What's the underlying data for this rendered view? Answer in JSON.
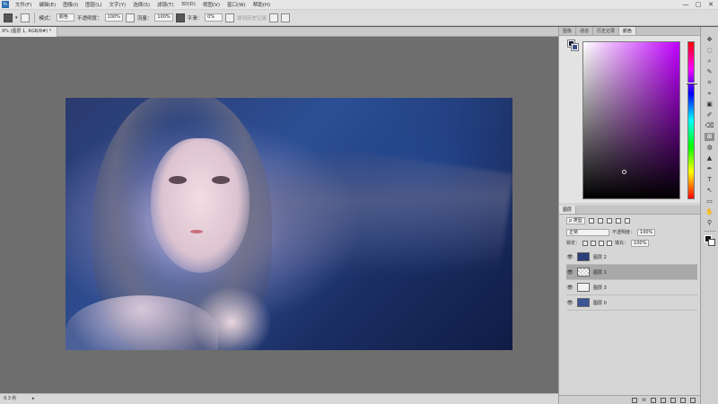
{
  "menubar": {
    "logo": "Ps",
    "items": [
      "文件(F)",
      "编辑(E)",
      "图像(I)",
      "图层(L)",
      "文字(Y)",
      "选择(S)",
      "滤镜(T)",
      "3D(D)",
      "视图(V)",
      "窗口(W)",
      "帮助(H)"
    ],
    "window_controls": [
      "—",
      "▢",
      "✕"
    ]
  },
  "options": {
    "mode_label": "模式：",
    "mode_value": "颜色",
    "opacity_label": "不透明度：",
    "opacity_value": "100%",
    "flow_label": "流量：",
    "flow_value": "100%",
    "smoothing_label": "平滑：",
    "smoothing_value": "0%",
    "history_label": "抹到历史记录"
  },
  "document": {
    "tab_title": "9% (图层 1, RGB/8#) *",
    "zoom_status": "9.3 秒"
  },
  "panels": {
    "top_tabs": [
      "图像",
      "通道",
      "历史记录",
      "颜色"
    ],
    "layers_tab": "图层",
    "kind_label": "ρ 类型",
    "blend_mode": "正常",
    "opacity_label": "不透明度：",
    "opacity_value": "100%",
    "lock_label": "锁定：",
    "fill_label": "填充：",
    "fill_value": "100%",
    "layers": [
      {
        "name": "图层 2",
        "visible_icon": "👁",
        "selected": false,
        "thumb": "#2c3f7a"
      },
      {
        "name": "图层 1",
        "visible_icon": "👁",
        "selected": true,
        "thumb": "#e7e7e7"
      },
      {
        "name": "图层 3",
        "visible_icon": "👁",
        "selected": false,
        "thumb": "#f2f2f2"
      },
      {
        "name": "图层 0",
        "visible_icon": "👁",
        "selected": false,
        "thumb": "#3a5498"
      }
    ],
    "footer_fx": "fx"
  },
  "tools": {
    "icons": [
      "✥",
      "◌",
      "⌕",
      "✎",
      "⌗",
      "⌖",
      "▣",
      "✐",
      "⌫",
      "⊞",
      "◍",
      "▲",
      "✒",
      "T",
      "↖",
      "▭",
      "✋",
      "⚲"
    ]
  }
}
